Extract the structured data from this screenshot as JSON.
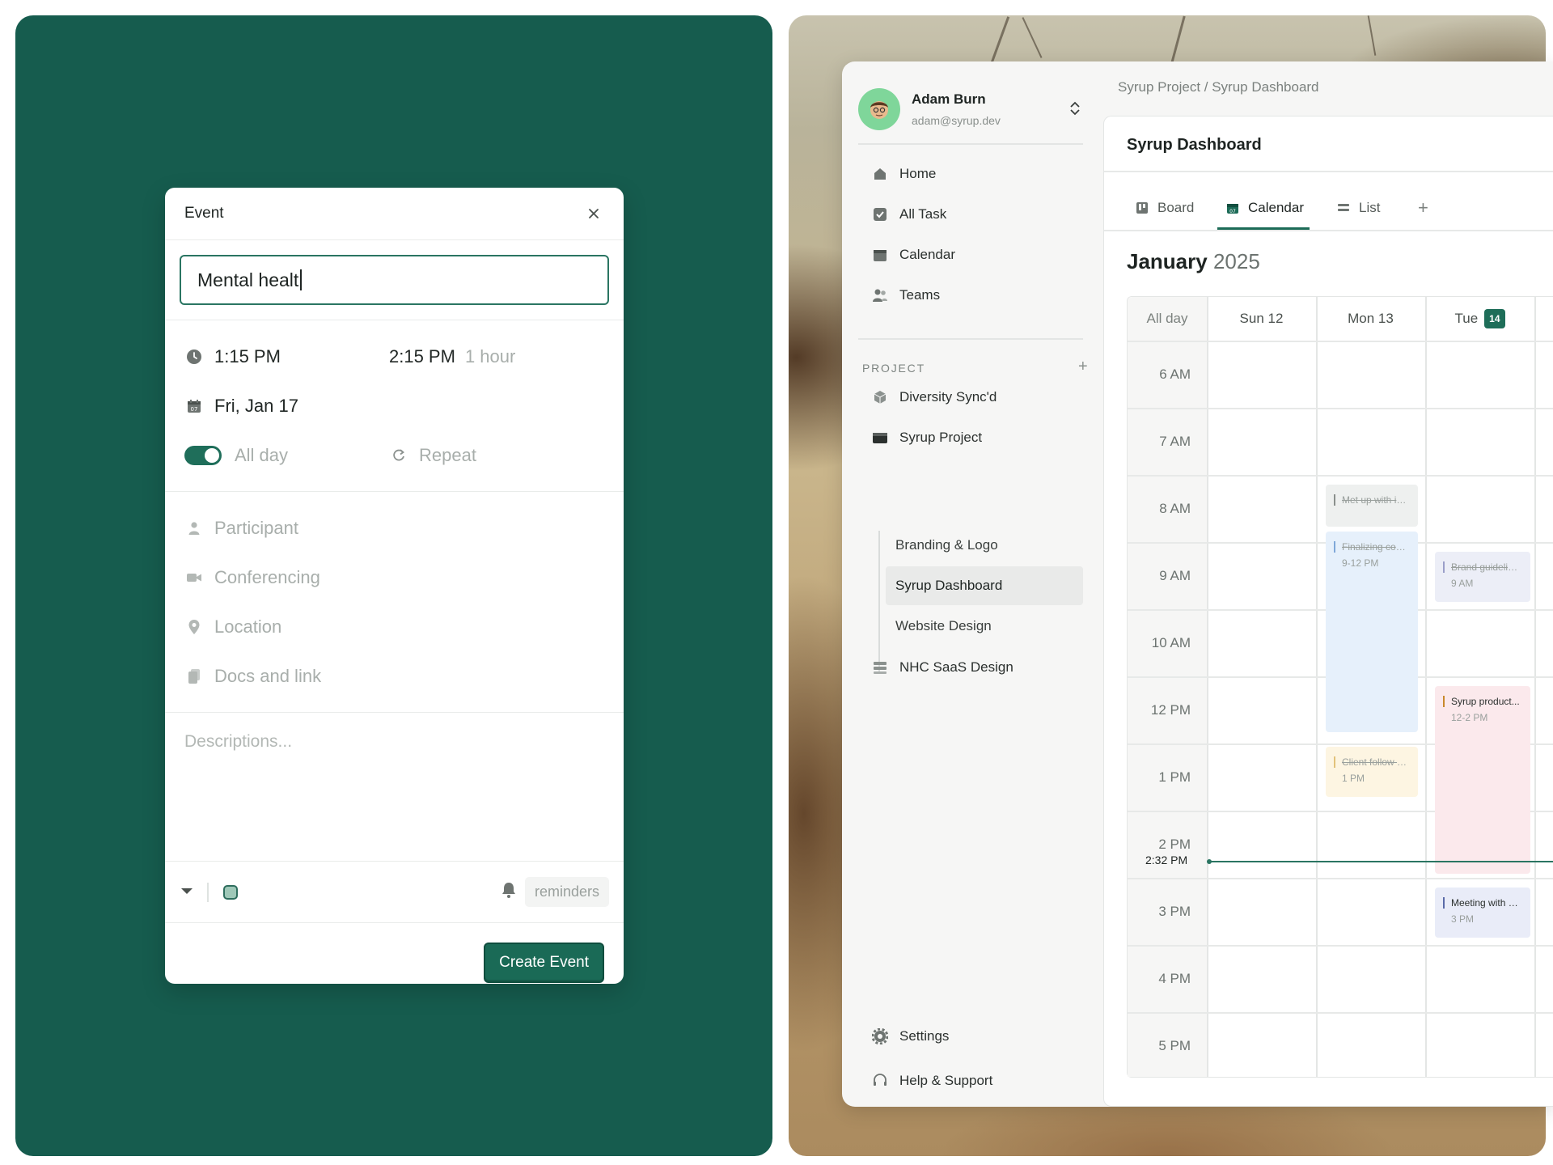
{
  "event_modal": {
    "title": "Event",
    "name_value": "Mental healt",
    "start_time": "1:15 PM",
    "end_time": "2:15 PM",
    "duration": "1 hour",
    "date": "Fri, Jan 17",
    "all_day_label": "All day",
    "all_day_on": true,
    "repeat_label": "Repeat",
    "participant_placeholder": "Participant",
    "conferencing_placeholder": "Conferencing",
    "location_placeholder": "Location",
    "docs_placeholder": "Docs and link",
    "description_placeholder": "Descriptions...",
    "reminders_label": "reminders",
    "create_button": "Create Event",
    "colors": {
      "accent": "#1a6a56",
      "panel": "#165c4e",
      "event_color": "#9fc8b8"
    }
  },
  "sidebar": {
    "user": {
      "name": "Adam Burn",
      "email": "adam@syrup.dev"
    },
    "nav": [
      {
        "label": "Home",
        "icon": "home-icon"
      },
      {
        "label": "All Task",
        "icon": "checkbox-icon"
      },
      {
        "label": "Calendar",
        "icon": "calendar-icon"
      },
      {
        "label": "Teams",
        "icon": "people-icon"
      }
    ],
    "project_header": "PROJECT",
    "projects": [
      {
        "label": "Diversity Sync'd",
        "icon": "cube-icon"
      },
      {
        "label": "Syrup Project",
        "icon": "folder-icon"
      },
      {
        "label": "NHC SaaS Design",
        "icon": "server-icon"
      }
    ],
    "subprojects": [
      {
        "label": "Branding & Logo",
        "active": false
      },
      {
        "label": "Syrup Dashboard",
        "active": true
      },
      {
        "label": "Website Design",
        "active": false
      }
    ],
    "settings_label": "Settings",
    "help_label": "Help & Support"
  },
  "main": {
    "breadcrumb": "Syrup Project / Syrup Dashboard",
    "title": "Syrup Dashboard",
    "tabs": [
      {
        "label": "Board",
        "icon": "board-icon",
        "active": false
      },
      {
        "label": "Calendar",
        "icon": "calendar-icon",
        "active": true
      },
      {
        "label": "List",
        "icon": "list-icon",
        "active": false
      }
    ],
    "month": "January",
    "year": "2025"
  },
  "calendar": {
    "all_day_label": "All day",
    "days": [
      {
        "label": "Sun 12"
      },
      {
        "label": "Mon 13"
      },
      {
        "label": "Tue",
        "badge": "14",
        "today": true
      }
    ],
    "hours": [
      "6 AM",
      "7 AM",
      "8 AM",
      "9 AM",
      "10 AM",
      "12 PM",
      "1 PM",
      "2 PM",
      "3 PM",
      "4 PM",
      "5 PM"
    ],
    "now_label": "2:32 PM",
    "events": [
      {
        "title": "Met up with int...",
        "time": "",
        "day": "Mon 13",
        "done": true,
        "color": "#8a8f8c",
        "bg": "#eef0ef"
      },
      {
        "title": "Finalizing cont...",
        "time": "9-12 PM",
        "day": "Mon 13",
        "done": true,
        "color": "#7fa7d8",
        "bg": "#e6f0fb"
      },
      {
        "title": "Client follow u...",
        "time": "1 PM",
        "day": "Mon 13",
        "done": true,
        "color": "#e2c27a",
        "bg": "#fdf5e2"
      },
      {
        "title": "Brand guideline...",
        "time": "9 AM",
        "day": "Tue",
        "done": true,
        "color": "#9a9ec9",
        "bg": "#eceef7"
      },
      {
        "title": "Syrup product...",
        "time": "12-2 PM",
        "day": "Tue",
        "done": false,
        "color": "#c9892b",
        "bg": "#fbe9ec"
      },
      {
        "title": "Meeting with m...",
        "time": "3 PM",
        "day": "Tue",
        "done": false,
        "color": "#5a6aa8",
        "bg": "#e9ecf8"
      }
    ]
  }
}
